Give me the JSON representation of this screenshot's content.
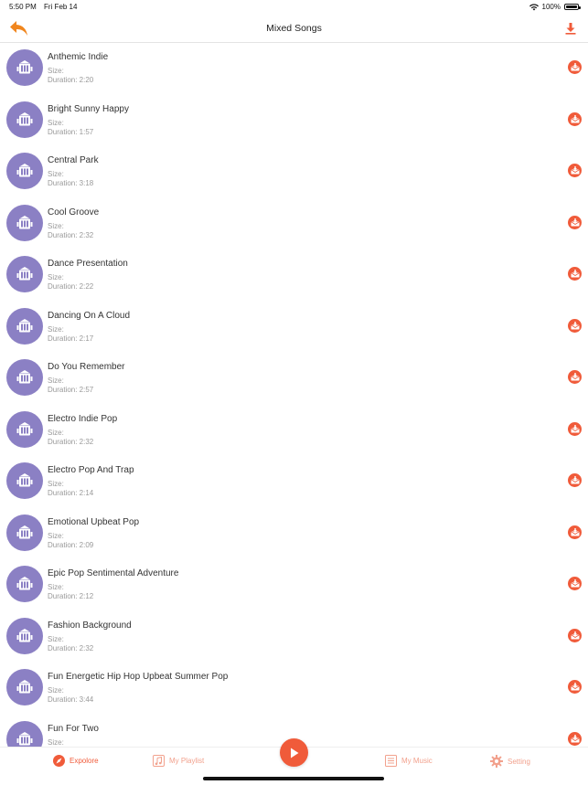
{
  "status_bar": {
    "time": "5:50 PM",
    "date": "Fri Feb 14",
    "battery": "100%"
  },
  "header": {
    "title": "Mixed Songs"
  },
  "songs": [
    {
      "title": "Anthemic Indie",
      "size_label": "Size:",
      "duration_label": "Duration: 2:20"
    },
    {
      "title": "Bright Sunny Happy",
      "size_label": "Size:",
      "duration_label": "Duration: 1:57"
    },
    {
      "title": "Central Park",
      "size_label": "Size:",
      "duration_label": "Duration: 3:18"
    },
    {
      "title": "Cool Groove",
      "size_label": "Size:",
      "duration_label": "Duration: 2:32"
    },
    {
      "title": "Dance Presentation",
      "size_label": "Size:",
      "duration_label": "Duration: 2:22"
    },
    {
      "title": "Dancing On A Cloud",
      "size_label": "Size:",
      "duration_label": "Duration: 2:17"
    },
    {
      "title": "Do You Remember",
      "size_label": "Size:",
      "duration_label": "Duration: 2:57"
    },
    {
      "title": "Electro Indie Pop",
      "size_label": "Size:",
      "duration_label": "Duration: 2:32"
    },
    {
      "title": "Electro Pop And Trap",
      "size_label": "Size:",
      "duration_label": "Duration: 2:14"
    },
    {
      "title": "Emotional Upbeat Pop",
      "size_label": "Size:",
      "duration_label": "Duration: 2:09"
    },
    {
      "title": "Epic Pop Sentimental Adventure",
      "size_label": "Size:",
      "duration_label": "Duration: 2:12"
    },
    {
      "title": "Fashion Background",
      "size_label": "Size:",
      "duration_label": "Duration: 2:32"
    },
    {
      "title": "Fun Energetic Hip Hop Upbeat Summer Pop",
      "size_label": "Size:",
      "duration_label": "Duration: 3:44"
    },
    {
      "title": "Fun For Two",
      "size_label": "Size:",
      "duration_label": ""
    }
  ],
  "tabs": [
    {
      "label": "Expolore",
      "icon": "compass-icon",
      "active": true
    },
    {
      "label": "My Playlist",
      "icon": "playlist-icon",
      "active": false
    },
    {
      "label": "My Music",
      "icon": "list-icon",
      "active": false
    },
    {
      "label": "Setting",
      "icon": "gear-icon",
      "active": false
    }
  ],
  "colors": {
    "accent": "#f05b3a",
    "accent_light": "#f2a18d",
    "thumb": "#8b80c4"
  }
}
